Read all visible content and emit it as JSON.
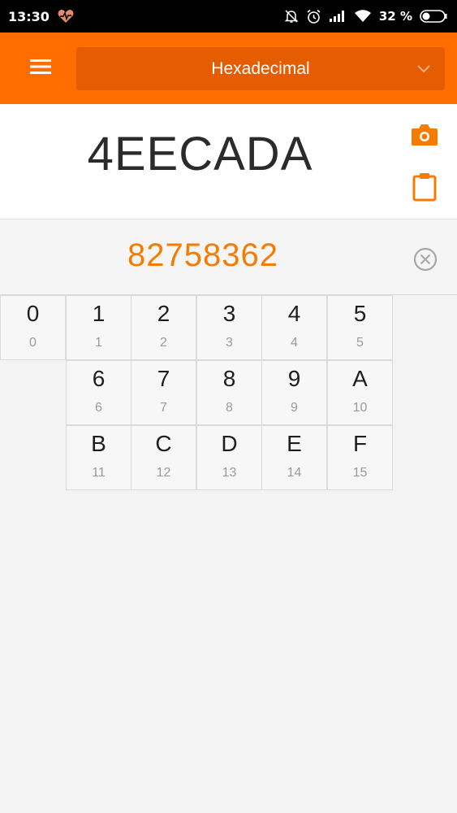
{
  "status_bar": {
    "time": "13:30",
    "battery_percent": "32 %",
    "icons": [
      "heart-monitor-icon",
      "bell-off-icon",
      "alarm-icon",
      "signal-icon",
      "wifi-icon",
      "battery-icon"
    ]
  },
  "app_bar": {
    "menu_icon": "hamburger-menu-icon",
    "base_selector": "Hexadecimal",
    "dropdown_icon": "chevron-down-icon"
  },
  "result": {
    "value": "4EECADA",
    "actions": [
      "camera-icon",
      "clipboard-icon"
    ]
  },
  "input": {
    "value": "82758362",
    "clear_icon": "clear-circle-icon"
  },
  "keypad": {
    "keys": [
      {
        "digit": "0",
        "value": "0"
      },
      {
        "digit": "1",
        "value": "1"
      },
      {
        "digit": "2",
        "value": "2"
      },
      {
        "digit": "3",
        "value": "3"
      },
      {
        "digit": "4",
        "value": "4"
      },
      {
        "digit": "5",
        "value": "5"
      },
      {
        "digit": "6",
        "value": "6"
      },
      {
        "digit": "7",
        "value": "7"
      },
      {
        "digit": "8",
        "value": "8"
      },
      {
        "digit": "9",
        "value": "9"
      },
      {
        "digit": "A",
        "value": "10"
      },
      {
        "digit": "B",
        "value": "11"
      },
      {
        "digit": "C",
        "value": "12"
      },
      {
        "digit": "D",
        "value": "13"
      },
      {
        "digit": "E",
        "value": "14"
      },
      {
        "digit": "F",
        "value": "15"
      }
    ]
  },
  "colors": {
    "accent": "#ff6d00",
    "accent_dark": "#e65c00",
    "input_text": "#f57c00"
  }
}
